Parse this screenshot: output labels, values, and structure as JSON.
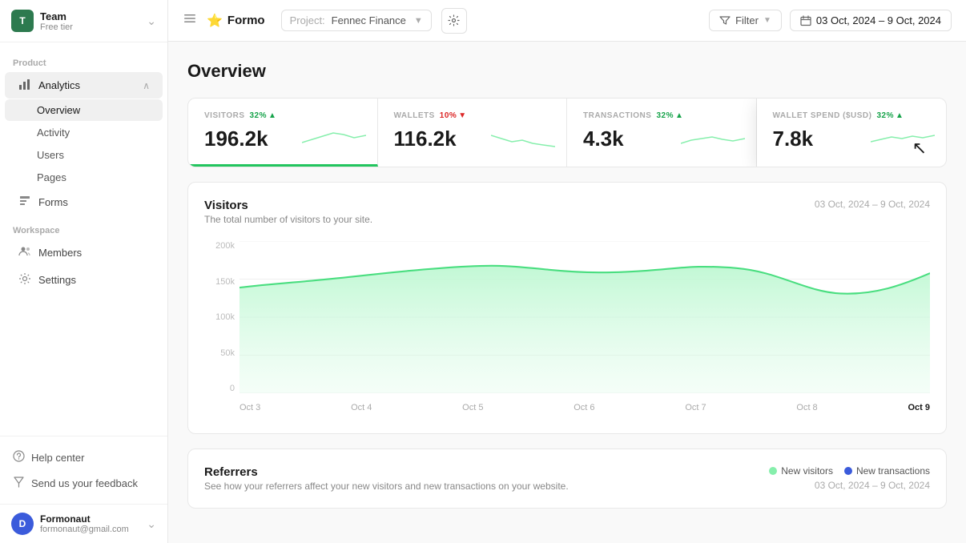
{
  "sidebar": {
    "team": {
      "name": "Team",
      "tier": "Free tier",
      "avatar_letter": "T"
    },
    "product_label": "Product",
    "analytics_label": "Analytics",
    "nav_items": [
      {
        "id": "overview",
        "label": "Overview",
        "active": true
      },
      {
        "id": "activity",
        "label": "Activity",
        "active": false
      },
      {
        "id": "users",
        "label": "Users",
        "active": false
      },
      {
        "id": "pages",
        "label": "Pages",
        "active": false
      }
    ],
    "forms_label": "Forms",
    "workspace_label": "Workspace",
    "members_label": "Members",
    "settings_label": "Settings",
    "help_label": "Help center",
    "feedback_label": "Send us your feedback",
    "user": {
      "name": "Formonaut",
      "email": "formonaut@gmail.com",
      "avatar_letter": "D"
    }
  },
  "topbar": {
    "logo_text": "Formo",
    "project_label": "Project:",
    "project_name": "Fennec Finance",
    "filter_label": "Filter",
    "date_range": "03 Oct, 2024 – 9 Oct, 2024"
  },
  "overview": {
    "title": "Overview",
    "stats": [
      {
        "id": "visitors",
        "label": "VISITORS",
        "value": "196.2k",
        "badge": "32%",
        "trend": "up"
      },
      {
        "id": "wallets",
        "label": "WALLETS",
        "value": "116.2k",
        "badge": "10%",
        "trend": "down"
      },
      {
        "id": "transactions",
        "label": "TRANSACTIONS",
        "value": "4.3k",
        "badge": "32%",
        "trend": "up"
      },
      {
        "id": "wallet_spend",
        "label": "WALLET SPEND ($USD)",
        "value": "7.8k",
        "badge": "32%",
        "trend": "up",
        "highlighted": true
      }
    ],
    "chart": {
      "title": "Visitors",
      "subtitle": "The total number of visitors to your site.",
      "date_range": "03 Oct, 2024 – 9 Oct, 2024",
      "y_labels": [
        "200k",
        "150k",
        "100k",
        "50k",
        "0"
      ],
      "x_labels": [
        {
          "label": "Oct 3",
          "bold": false
        },
        {
          "label": "Oct 4",
          "bold": false
        },
        {
          "label": "Oct 5",
          "bold": false
        },
        {
          "label": "Oct 6",
          "bold": false
        },
        {
          "label": "Oct 7",
          "bold": false
        },
        {
          "label": "Oct 8",
          "bold": false
        },
        {
          "label": "Oct 9",
          "bold": true
        }
      ]
    },
    "referrers": {
      "title": "Referrers",
      "subtitle": "See how your referrers affect your new visitors and new transactions on your website.",
      "date_range": "03 Oct, 2024 – 9 Oct, 2024",
      "legend": [
        {
          "label": "New visitors",
          "color": "#86efac"
        },
        {
          "label": "New transactions",
          "color": "#3b5bdb"
        }
      ]
    }
  }
}
